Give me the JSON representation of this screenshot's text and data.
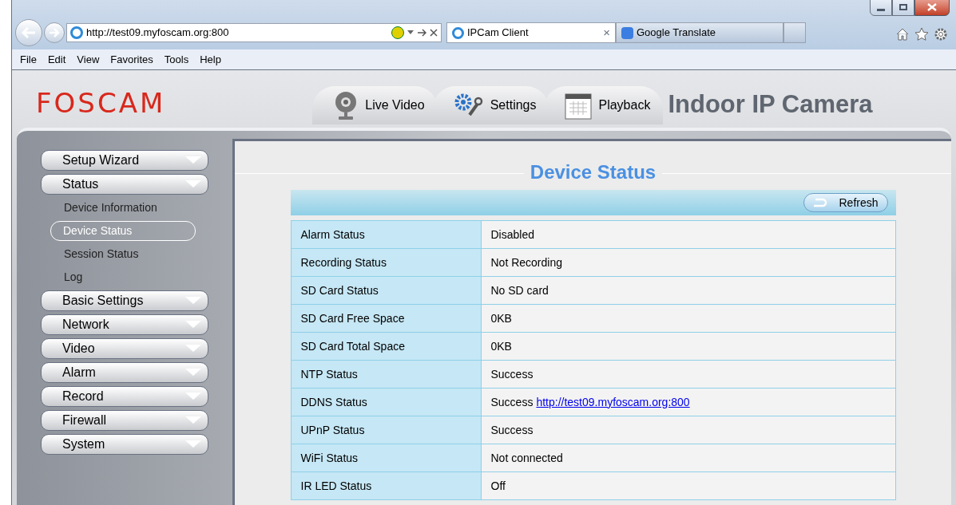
{
  "browser": {
    "address": "http://test09.myfoscam.org:800",
    "tabs": [
      {
        "title": "IPCam Client",
        "selected": true,
        "close": "×"
      },
      {
        "title": "Google Translate",
        "selected": false
      }
    ],
    "menu": [
      "File",
      "Edit",
      "View",
      "Favorites",
      "Tools",
      "Help"
    ]
  },
  "header": {
    "logo": "FOSCAM",
    "product": "Indoor IP Camera",
    "tabs": [
      {
        "label": "Live Video",
        "kind": "live"
      },
      {
        "label": "Settings",
        "kind": "settings"
      },
      {
        "label": "Playback",
        "kind": "playback"
      }
    ]
  },
  "sidebar": [
    {
      "label": "Setup Wizard"
    },
    {
      "label": "Status",
      "children": [
        {
          "label": "Device Information",
          "selected": false
        },
        {
          "label": "Device Status",
          "selected": true
        },
        {
          "label": "Session Status",
          "selected": false
        },
        {
          "label": "Log",
          "selected": false
        }
      ]
    },
    {
      "label": "Basic Settings"
    },
    {
      "label": "Network"
    },
    {
      "label": "Video"
    },
    {
      "label": "Alarm"
    },
    {
      "label": "Record"
    },
    {
      "label": "Firewall"
    },
    {
      "label": "System"
    }
  ],
  "content": {
    "title": "Device Status",
    "refresh": "Refresh",
    "rows": [
      {
        "label": "Alarm Status",
        "value": "Disabled"
      },
      {
        "label": "Recording Status",
        "value": "Not Recording"
      },
      {
        "label": "SD Card Status",
        "value": "No SD card"
      },
      {
        "label": "SD Card Free Space",
        "value": "0KB"
      },
      {
        "label": "SD Card Total Space",
        "value": "0KB"
      },
      {
        "label": "NTP Status",
        "value": "Success"
      },
      {
        "label": "DDNS Status",
        "value": "Success",
        "link": "http://test09.myfoscam.org:800"
      },
      {
        "label": "UPnP Status",
        "value": "Success"
      },
      {
        "label": "WiFi Status",
        "value": "Not connected"
      },
      {
        "label": "IR LED Status",
        "value": "Off"
      }
    ]
  }
}
